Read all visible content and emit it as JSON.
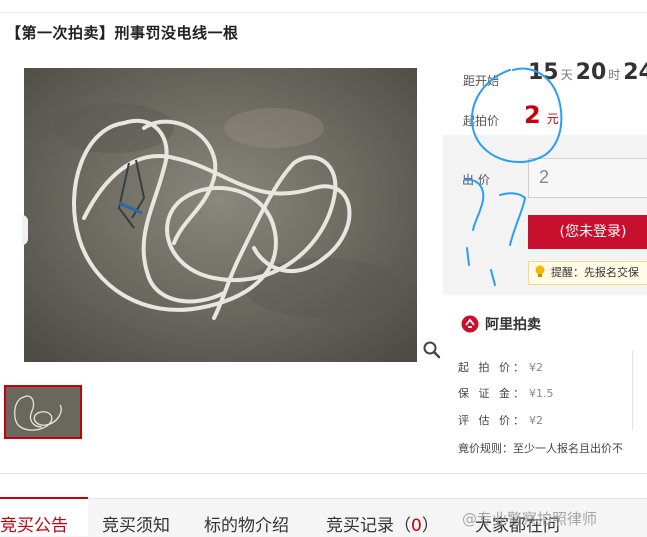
{
  "title": "【第一次拍卖】刑事罚没电线一根",
  "countdown": {
    "label": "距开始",
    "days": "15",
    "days_unit": "天",
    "hours": "20",
    "hours_unit": "时",
    "minutes": "24"
  },
  "start_price": {
    "label": "起拍价",
    "value": "2",
    "unit": "元"
  },
  "bid": {
    "label": "出 价",
    "value": "2",
    "button_label": "(您未登录)",
    "tip": "提醒：先报名交保"
  },
  "brand": "阿里拍卖",
  "info": {
    "start_price_label": "起 拍 价：",
    "start_price_value": "¥2",
    "deposit_label": "保 证 金：",
    "deposit_value": "¥1.5",
    "estimate_label": "评 估 价：",
    "estimate_value": "¥2",
    "rule": "竟价规则：至少一人报名且出价不"
  },
  "tabs": [
    {
      "label": "竞买公告"
    },
    {
      "label": "竞买须知"
    },
    {
      "label": "标的物介绍"
    },
    {
      "label": "竞买记录",
      "count_open": "（",
      "count": "0",
      "count_close": "）"
    },
    {
      "label": "大家都在问"
    }
  ],
  "watermark": "@专业警察拍照律师",
  "colors": {
    "accent": "#c7000b",
    "button": "#c8102e",
    "scribble": "#2a9df4"
  },
  "icons": [
    "zoom-icon",
    "bulb-icon",
    "alibaba-auction-logo-icon"
  ]
}
